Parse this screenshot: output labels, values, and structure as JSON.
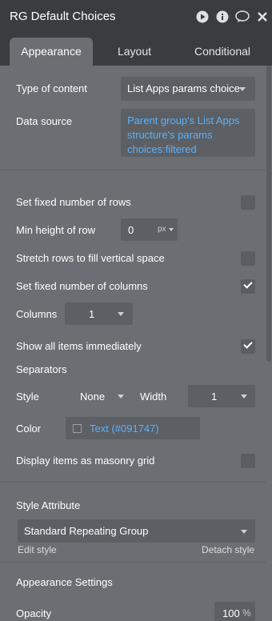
{
  "header": {
    "title": "RG Default Choices"
  },
  "header_icons": [
    "play-icon",
    "info-icon",
    "comment-icon",
    "close-icon"
  ],
  "tabs": [
    {
      "label": "Appearance"
    },
    {
      "label": "Layout"
    },
    {
      "label": "Conditional"
    }
  ],
  "fields": {
    "type_of_content": {
      "label": "Type of content",
      "value": "List Apps params choice"
    },
    "data_source": {
      "label": "Data source",
      "lines": [
        "Parent group's List Apps",
        "structure's params",
        "choices:filtered"
      ]
    },
    "set_fixed_rows": {
      "label": "Set fixed number of rows",
      "checked": false
    },
    "min_height_row": {
      "label": "Min height of row",
      "value": "0",
      "unit": "px"
    },
    "stretch_rows": {
      "label": "Stretch rows to fill vertical space",
      "checked": false
    },
    "set_fixed_columns": {
      "label": "Set fixed number of columns",
      "checked": true
    },
    "columns": {
      "label": "Columns",
      "value": "1"
    },
    "show_all_items": {
      "label": "Show all items immediately",
      "checked": true
    },
    "separators": {
      "label": "Separators"
    },
    "sep_style": {
      "label": "Style",
      "value": "None"
    },
    "sep_width": {
      "label": "Width",
      "value": "1"
    },
    "sep_color": {
      "label": "Color",
      "value": "Text (#091747)"
    },
    "masonry": {
      "label": "Display items as masonry grid",
      "checked": false
    },
    "style_attribute": {
      "label": "Style Attribute",
      "value": "Standard Repeating Group",
      "edit_label": "Edit style",
      "detach_label": "Detach style"
    },
    "appearance_settings": {
      "label": "Appearance Settings"
    },
    "opacity": {
      "label": "Opacity",
      "value": "100",
      "unit": "%"
    }
  },
  "colors": {
    "panel": "#6b6e72",
    "header": "#3a3c3f",
    "input": "#5c5f63",
    "link": "#5ab1ff"
  }
}
